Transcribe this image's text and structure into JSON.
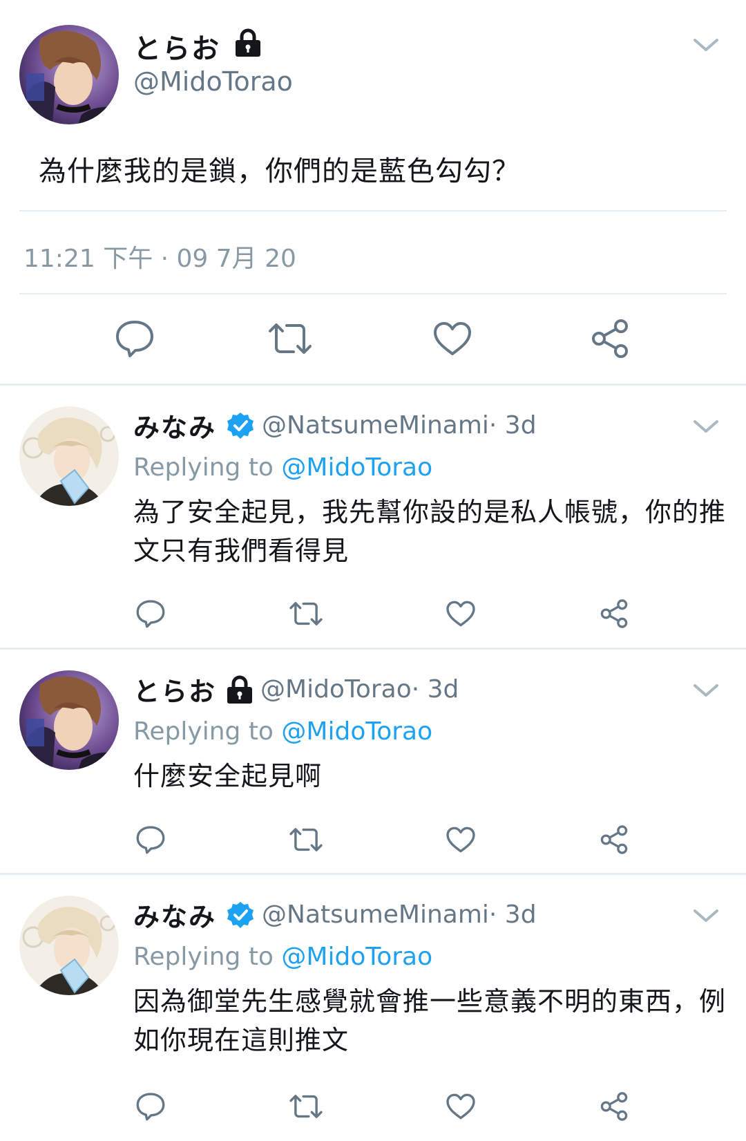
{
  "main_tweet": {
    "display_name": "とらお",
    "handle": "@MidoTorao",
    "text": "為什麼我的是鎖，你們的是藍色勾勾？",
    "timestamp": "11:21 下午 · 09 7月 20",
    "protected_icon": "lock-icon"
  },
  "replies": [
    {
      "display_name": "みなみ",
      "handle": "@NatsumeMinami",
      "time": " · 3d",
      "badge": "verified-icon",
      "replying_label": "Replying to ",
      "replying_to": "@MidoTorao",
      "text": "為了安全起見，我先幫你設的是私人帳號，你的推文只有我們看得見"
    },
    {
      "display_name": "とらお",
      "handle": "@MidoTorao",
      "time": " · 3d",
      "badge": "lock-icon",
      "replying_label": "Replying to ",
      "replying_to": "@MidoTorao",
      "text": "什麼安全起見啊"
    },
    {
      "display_name": "みなみ",
      "handle": "@NatsumeMinami",
      "time": " · 3d",
      "badge": "verified-icon",
      "replying_label": "Replying to ",
      "replying_to": "@MidoTorao",
      "text": "因為御堂先生感覺就會推一些意義不明的東西，例如你現在這則推文"
    }
  ],
  "actions": [
    "reply-icon",
    "retweet-icon",
    "like-icon",
    "share-icon"
  ],
  "colors": {
    "link": "#1da1f2",
    "verified": "#1da1f2",
    "secondary_text": "#657786",
    "icon": "#657786",
    "divider": "#e6ecf0"
  }
}
